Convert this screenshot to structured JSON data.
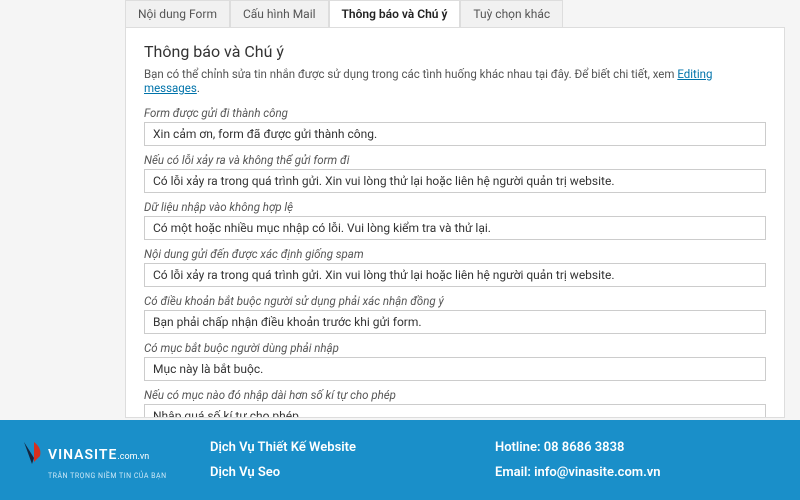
{
  "tabs": [
    {
      "label": "Nội dung Form"
    },
    {
      "label": "Cấu hình Mail"
    },
    {
      "label": "Thông báo và Chú ý"
    },
    {
      "label": "Tuỳ chọn khác"
    }
  ],
  "panel": {
    "title": "Thông báo và Chú ý",
    "desc_prefix": "Bạn có thể chỉnh sửa tin nhắn được sử dụng trong các tình huống khác nhau tại đây. Để biết chi tiết, xem ",
    "desc_link": "Editing messages",
    "desc_suffix": "."
  },
  "fields": [
    {
      "label": "Form được gửi đi thành công",
      "value": "Xin cảm ơn, form đã được gửi thành công."
    },
    {
      "label": "Nếu có lỗi xảy ra và không thể gửi form đi",
      "value": "Có lỗi xảy ra trong quá trình gửi. Xin vui lòng thử lại hoặc liên hệ người quản trị website."
    },
    {
      "label": "Dữ liệu nhập vào không hợp lệ",
      "value": "Có một hoặc nhiều mục nhập có lỗi. Vui lòng kiểm tra và thử lại."
    },
    {
      "label": "Nội dung gửi đến được xác định giống spam",
      "value": "Có lỗi xảy ra trong quá trình gửi. Xin vui lòng thử lại hoặc liên hệ người quản trị website."
    },
    {
      "label": "Có điều khoản bắt buộc người sử dụng phải xác nhận đồng ý",
      "value": "Bạn phải chấp nhận điều khoản trước khi gửi form."
    },
    {
      "label": "Có mục bắt buộc người dùng phải nhập",
      "value": "Mục này là bắt buộc."
    },
    {
      "label": "Nếu có mục nào đó nhập dài hơn số kí tự cho phép",
      "value": "Nhập quá số kí tự cho phép."
    }
  ],
  "footer": {
    "brand_main": "VINASITE",
    "brand_sub": ".com.vn",
    "tagline": "TRÂN TRỌNG NIỀM TIN CỦA BẠN",
    "service1": "Dịch Vụ Thiết Kế Website",
    "service2": "Dịch Vụ Seo",
    "hotline_label": "Hotline: ",
    "hotline": "08 8686 3838",
    "email_label": "Email: ",
    "email": "info@vinasite.com.vn"
  }
}
